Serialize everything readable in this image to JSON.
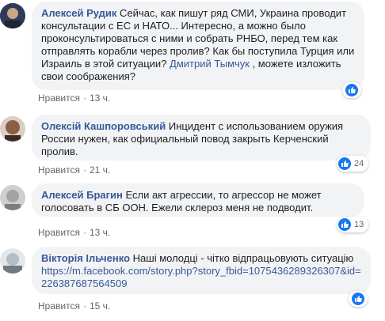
{
  "comments": [
    {
      "author": "Алексей Рудик",
      "text_before": " Сейчас, как пишут ряд СМИ, Украина проводит консультации с ЕС и НАТО... Интересно, а можно было проконсультироваться с ними и собрать РНБО, перед тем как отправлять корабли через пролив? Как бы поступила Турция или Израиль в этой ситуации? ",
      "mention": "Дмитрий Тымчук",
      "text_after": " , можете изложить свои соображения?",
      "like_label": "Нравится",
      "time": "13 ч.",
      "reactions": "",
      "avatar_color": "#3b4a6b"
    },
    {
      "author": "Олексій Кашпоровський",
      "text": " Инцидент с использованием оружия России нужен, как официальный повод закрыть Керченский пролив.",
      "like_label": "Нравится",
      "time": "21 ч.",
      "reactions": "24",
      "avatar_color": "#7a5a45"
    },
    {
      "author": "Алексей Брагин",
      "text": " Если акт агрессии, то агрессор не может голосовать в СБ ООН. Ежели склероз меня не подводит.",
      "like_label": "Нравится",
      "time": "13 ч.",
      "reactions": "13",
      "avatar_color": "#a8a8a8"
    },
    {
      "author": "Вікторія Ільченко",
      "text": " Наші молодці - чітко відпрацьовують ситуацію",
      "link": "https://m.facebook.com/story.php?story_fbid=1075436289326307&id=226387687564509",
      "like_label": "Нравится",
      "time": "15 ч.",
      "reactions": "",
      "avatar_color": "#9aa6b0"
    }
  ]
}
